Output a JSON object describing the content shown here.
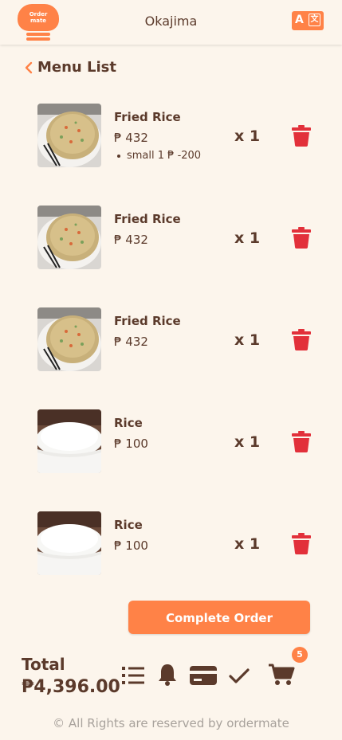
{
  "app": {
    "logo_text_line1": "Order",
    "logo_text_line2": "mate",
    "title": "Okajima",
    "lang_icon": "translate-icon"
  },
  "header": {
    "title": "Menu List",
    "back_icon": "chevron-left-icon"
  },
  "items": [
    {
      "name": "Fried Rice",
      "price": "₱ 432",
      "option": "small 1 ₱ -200",
      "qty": "x 1",
      "image": "fried-rice"
    },
    {
      "name": "Fried Rice",
      "price": "₱ 432",
      "option": "",
      "qty": "x 1",
      "image": "fried-rice"
    },
    {
      "name": "Fried Rice",
      "price": "₱ 432",
      "option": "",
      "qty": "x 1",
      "image": "fried-rice"
    },
    {
      "name": "Rice",
      "price": "₱ 100",
      "option": "",
      "qty": "x 1",
      "image": "rice"
    },
    {
      "name": "Rice",
      "price": "₱ 100",
      "option": "",
      "qty": "x 1",
      "image": "rice"
    }
  ],
  "actions": {
    "complete_label": "Complete Order"
  },
  "summary": {
    "total_label": "Total",
    "total_value": "₱4,396.00"
  },
  "nav": {
    "icons": [
      "list-icon",
      "bell-icon",
      "credit-card-icon",
      "check-icon",
      "cart-icon"
    ],
    "cart_badge": "5"
  },
  "footer": {
    "text": "© All Rights are reserved by ordermate"
  },
  "colors": {
    "accent": "#ff8247",
    "text": "#5b3a2b",
    "background": "#fcf5ec",
    "delete": "#e2303a",
    "footer_text": "#a8a29c"
  }
}
